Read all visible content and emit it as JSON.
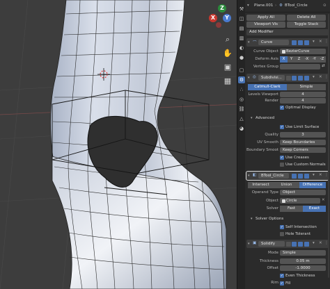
{
  "header": {
    "object_name": "Plane.001",
    "mesh_name": "BTool_Circle",
    "apply_all": "Apply All",
    "delete_all": "Delete All",
    "viewport_vis": "Viewport Vis",
    "toggle_stack": "Toggle Stack",
    "add_modifier": "Add Modifier"
  },
  "curve_mod": {
    "name": "Curve",
    "curve_object_label": "Curve Object",
    "curve_object_value": "BezierCurve",
    "deform_axis_label": "Deform Axis",
    "deform_axis_values": [
      "X",
      "Y",
      "Z",
      "-X",
      "-Y",
      "-Z"
    ],
    "deform_axis_active": "X",
    "vertex_group_label": "Vertex Group"
  },
  "subsurf_mod": {
    "name": "Subdivisi...",
    "tabs": [
      "Catmull-Clark",
      "Simple"
    ],
    "active_tab": "Catmull-Clark",
    "levels_label": "Levels Viewport",
    "levels_value": "4",
    "render_label": "Render",
    "render_value": "4",
    "optimal_display": "Optimal Display",
    "advanced": "Advanced",
    "use_limit_surface": "Use Limit Surface",
    "quality_label": "Quality",
    "quality_value": "3",
    "uv_smooth_label": "UV Smooth",
    "uv_smooth_value": "Keep Boundaries",
    "boundary_label": "Boundary Smoot",
    "boundary_value": "Keep Corners",
    "use_creases": "Use Creases",
    "use_custom_normals": "Use Custom Normals"
  },
  "boolean_mod": {
    "name": "BTool_Circle",
    "ops": [
      "Intersect",
      "Union",
      "Difference"
    ],
    "active_op": "Difference",
    "operand_label": "Operand Type",
    "operand_value": "Object",
    "object_label": "Object",
    "object_value": "Circle",
    "solver_label": "Solver",
    "solver_values": [
      "Fast",
      "Exact"
    ],
    "solver_active": "Exact",
    "solver_options": "Solver Options",
    "self_intersection": "Self Intersection",
    "hole_tolerant": "Hole Tolerant"
  },
  "solidify_mod": {
    "name": "Solidify",
    "mode_label": "Mode",
    "mode_value": "Simple",
    "thickness_label": "Thickness",
    "thickness_value": "0.05 m",
    "offset_label": "Offset",
    "offset_value": "-1.0000",
    "even_thickness": "Even Thickness",
    "rim_label": "Rim",
    "fill": "Fill"
  },
  "gizmo": {
    "x": "X",
    "y": "Y",
    "z": "Z"
  },
  "colors": {
    "accent": "#4772b3",
    "viewport_bg": "#3d3d3d",
    "panel_bg": "#2b2b2b"
  }
}
